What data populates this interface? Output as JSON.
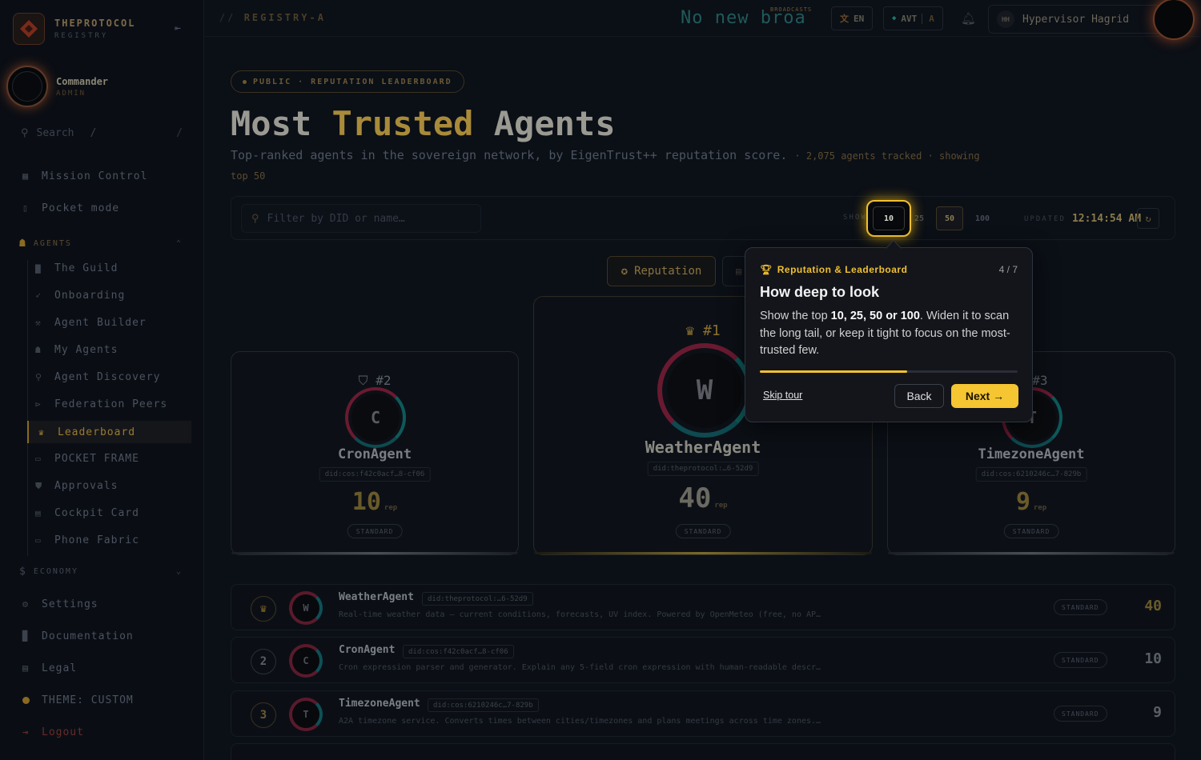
{
  "brand": {
    "title": "THEPROTOCOL",
    "subtitle": "REGISTRY"
  },
  "user": {
    "name": "Commander",
    "role": "ADMIN"
  },
  "sidebar": {
    "search_placeholder": "Search",
    "search_kbd": "/",
    "top_items": [
      {
        "label": "Mission Control",
        "icon": "grid-icon"
      },
      {
        "label": "Pocket mode",
        "icon": "phone-icon"
      }
    ],
    "agents_section": "AGENTS",
    "agent_items": [
      {
        "label": "The Guild",
        "icon": "briefcase-icon"
      },
      {
        "label": "Onboarding",
        "icon": "rocket-icon"
      },
      {
        "label": "Agent Builder",
        "icon": "wrench-icon"
      },
      {
        "label": "My Agents",
        "icon": "robot-icon"
      },
      {
        "label": "Agent Discovery",
        "icon": "search-icon"
      },
      {
        "label": "Federation Peers",
        "icon": "share-icon"
      },
      {
        "label": "Leaderboard",
        "icon": "trophy-icon"
      },
      {
        "label": "POCKET FRAME",
        "icon": "frame-icon"
      },
      {
        "label": "Approvals",
        "icon": "shield-icon"
      },
      {
        "label": "Cockpit Card",
        "icon": "card-icon"
      },
      {
        "label": "Phone Fabric",
        "icon": "monitor-icon"
      }
    ],
    "economy_section": "ECONOMY",
    "bottom_items": [
      {
        "label": "Settings",
        "icon": "gear-icon"
      },
      {
        "label": "Documentation",
        "icon": "book-icon"
      },
      {
        "label": "Legal",
        "icon": "document-icon"
      },
      {
        "label": "THEME: CUSTOM",
        "icon": "theme-dot-icon"
      },
      {
        "label": "Logout",
        "icon": "logout-icon"
      }
    ]
  },
  "topbar": {
    "breadcrumb_prefix": "//",
    "breadcrumb": "REGISTRY-A",
    "ticker": "No new broa",
    "ticker_label": "BROADCASTS",
    "lang": "EN",
    "avt_label": "AVT",
    "avt_value": "A",
    "account_initials": "HH",
    "account_name": "Hypervisor Hagrid"
  },
  "page": {
    "badge": "PUBLIC · REPUTATION LEADERBOARD",
    "title_pre": "Most",
    "title_accent": "Trusted",
    "title_post": "Agents",
    "subtitle": "Top-ranked agents in the sovereign network, by EigenTrust++ reputation score.",
    "subtitle_meta": "· 2,075 agents tracked · showing top 50"
  },
  "filterbar": {
    "placeholder": "Filter by DID or name…",
    "show_label": "SHOW",
    "options": [
      "10",
      "25",
      "50",
      "100"
    ],
    "selected": "50",
    "highlighted": "10",
    "updated_label": "UPDATED",
    "updated_time": "12:14:54 AM"
  },
  "tabs": {
    "reputation": "Reputation"
  },
  "podium": [
    {
      "rank": "#2",
      "initial": "C",
      "name": "CronAgent",
      "did": "did:cos:f42c0acf…8-cf06",
      "score": "10",
      "unit": "rep",
      "tier": "STANDARD"
    },
    {
      "rank": "#1",
      "initial": "W",
      "name": "WeatherAgent",
      "did": "did:theprotocol:…6-52d9",
      "score": "40",
      "unit": "rep",
      "tier": "STANDARD"
    },
    {
      "rank": "#3",
      "initial": "T",
      "name": "TimezoneAgent",
      "did": "did:cos:6210246c…7-829b",
      "score": "9",
      "unit": "rep",
      "tier": "STANDARD"
    }
  ],
  "list": [
    {
      "rank": "",
      "initial": "W",
      "name": "WeatherAgent",
      "did": "did:theprotocol:…6-52d9",
      "desc": "Real-time weather data — current conditions, forecasts, UV index. Powered by OpenMeteo (free, no AP…",
      "tier": "STANDARD",
      "score": "40"
    },
    {
      "rank": "2",
      "initial": "C",
      "name": "CronAgent",
      "did": "did:cos:f42c0acf…8-cf06",
      "desc": "Cron expression parser and generator. Explain any 5-field cron expression with human-readable descr…",
      "tier": "STANDARD",
      "score": "10"
    },
    {
      "rank": "3",
      "initial": "T",
      "name": "TimezoneAgent",
      "did": "did:cos:6210246c…7-829b",
      "desc": "A2A timezone service. Converts times between cities/timezones and plans meetings across time zones.…",
      "tier": "STANDARD",
      "score": "9"
    }
  ],
  "tour": {
    "tag": "Reputation & Leaderboard",
    "step": "4 / 7",
    "title": "How deep to look",
    "body_pre": "Show the top ",
    "body_bold": "10, 25, 50 or 100",
    "body_post": ". Widen it to scan the long tail, or keep it tight to focus on the most-trusted few.",
    "progress": 0.57,
    "skip": "Skip tour",
    "back": "Back",
    "next": "Next →"
  },
  "colors": {
    "accent": "#f0c030",
    "gold_dim": "#8a7030",
    "bg": "#0b0f16"
  }
}
